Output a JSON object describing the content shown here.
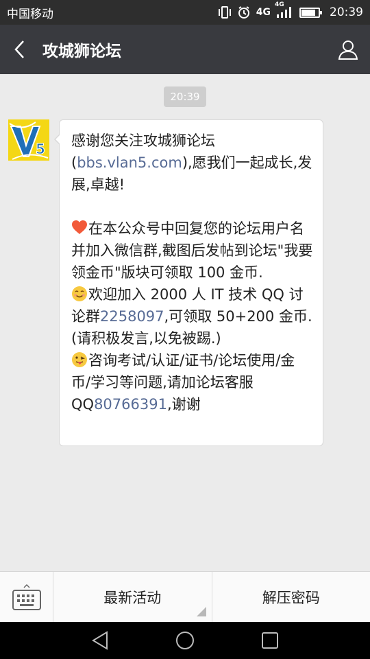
{
  "status_bar": {
    "carrier": "中国移动",
    "network": "4G",
    "network_small": "4G",
    "time": "20:39"
  },
  "header": {
    "title": "攻城狮论坛"
  },
  "chat": {
    "timestamp": "20:39",
    "avatar_text": "V5",
    "message": {
      "p1_a": "感谢您关注攻城狮论坛(",
      "p1_link": "bbs.vlan5.com",
      "p1_b": "),愿我们一起成长,发展,卓越!",
      "p2": "在本公众号中回复您的论坛用户名并加入微信群,截图后发帖到论坛\"我要领金币\"版块可领取 100 金币.",
      "p3_a": "欢迎加入 2000 人 IT 技术 QQ 讨论群",
      "p3_link": "2258097",
      "p3_b": ",可领取 50+200 金币.(请积极发言,以免被踢.)",
      "p4_a": "咨询考试/认证/证书/论坛使用/金币/学习等问题,请加论坛客服 QQ",
      "p4_link": "80766391",
      "p4_b": ",谢谢"
    }
  },
  "menu": {
    "items": [
      {
        "label": "最新活动"
      },
      {
        "label": "解压密码"
      }
    ]
  },
  "colors": {
    "link": "#576b95",
    "titlebar": "#393a3f",
    "avatar_bg": "#f4d715"
  },
  "icons": [
    "signal-icon",
    "alarm-icon",
    "vibrate-icon",
    "battery-icon",
    "back-icon",
    "profile-icon",
    "keyboard-icon",
    "heart-emoji",
    "smile-emoji",
    "tongue-emoji",
    "nav-back-icon",
    "nav-home-icon",
    "nav-recent-icon"
  ]
}
